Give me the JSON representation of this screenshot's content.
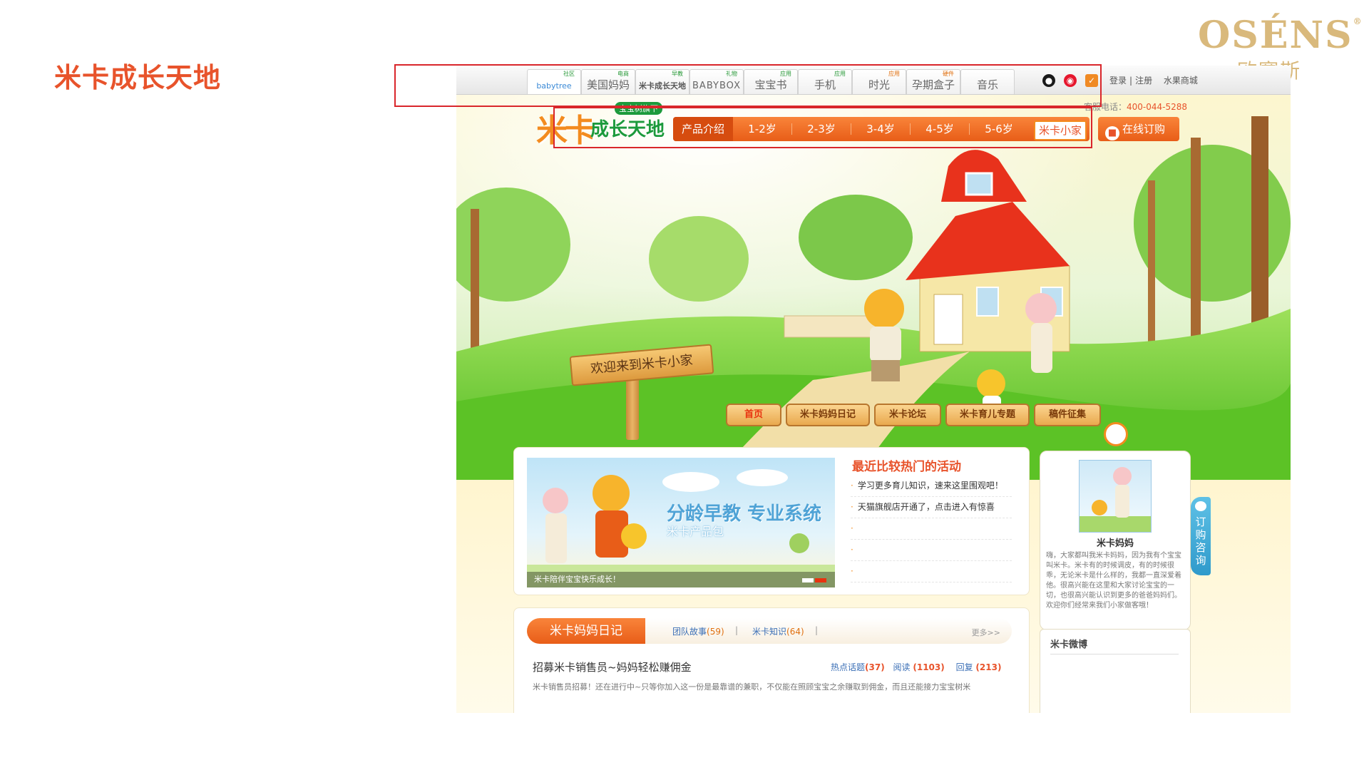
{
  "slide": {
    "title": "米卡成长天地",
    "brand_en": "OSÉNS",
    "brand_reg": "®",
    "brand_cn": "欧赛斯"
  },
  "topnav": {
    "tabs": [
      {
        "tag": "社区",
        "label": "babytree",
        "active": true
      },
      {
        "tag": "电商",
        "label": "美国妈妈"
      },
      {
        "tag": "早教",
        "label": "米卡成长天地"
      },
      {
        "tag": "礼物",
        "label": "BABYBOX"
      },
      {
        "tag": "应用",
        "label": "宝宝书"
      },
      {
        "tag": "应用",
        "label": "手机"
      },
      {
        "tag": "应用",
        "label": "时光",
        "hot": true
      },
      {
        "tag": "硬件",
        "label": "孕期盒子",
        "hot": true
      },
      {
        "tag": "",
        "label": "音乐"
      }
    ],
    "icons": [
      "qq-icon",
      "weibo-icon",
      "shield-icon"
    ],
    "login": "登录",
    "sep": "|",
    "register": "注册",
    "mall": "水果商城"
  },
  "header": {
    "hotline_label": "客服电话：",
    "hotline_number": "400-044-5288",
    "logo_mi": "米卡",
    "logo_text": "成长天地",
    "logo_badge": "宝宝树旗下",
    "nav": [
      "产品介绍",
      "1-2岁",
      "2-3岁",
      "3-4岁",
      "4-5岁",
      "5-6岁",
      "米卡小家"
    ],
    "order_label": "在线订购"
  },
  "scene": {
    "sign_text": "欢迎来到米卡小家",
    "subnav": [
      "首页",
      "米卡妈妈日记",
      "米卡论坛",
      "米卡育儿专题",
      "稿件征集"
    ]
  },
  "slider": {
    "banner_title": "分龄早教 专业系统",
    "banner_sub": "米卡产品包",
    "caption": "米卡陪伴宝宝快乐成长！",
    "dot_colors": [
      "#ffffff",
      "#e8320f"
    ]
  },
  "hot": {
    "title": "最近比较热门的活动",
    "items": [
      "学习更多育儿知识，速来这里围观吧！",
      "天猫旗舰店开通了，点击进入有惊喜",
      "",
      "",
      ""
    ]
  },
  "diary": {
    "tab": "米卡妈妈日记",
    "link1_label": "团队故事",
    "link1_count": "(59)",
    "link2_label": "米卡知识",
    "link2_count": "(64)",
    "sep": "|",
    "more": "更多>>",
    "post_title": "招募米卡销售员~妈妈轻松赚佣金",
    "meta_hot": "热点话题",
    "meta_hot_count": "(37)",
    "meta_read": "阅读",
    "meta_read_count": "(1103)",
    "meta_reply": "回复",
    "meta_reply_count": "(213)",
    "post_excerpt": "米卡销售员招募！还在进行中~只等你加入这一份是最靠谱的兼职，不仅能在照顾宝宝之余赚取到佣金，而且还能接力宝宝树米"
  },
  "mama": {
    "name": "米卡妈妈",
    "desc": "嗨，大家都叫我米卡妈妈，因为我有个宝宝叫米卡。米卡有的时候调皮，有的时候很乖，无论米卡是什么样的，我都一直深爱着他。很高兴能在这里和大家讨论宝宝的一切，也很高兴能认识到更多的爸爸妈妈们。欢迎你们经常来我们小家做客哦！"
  },
  "weibo": {
    "title": "米卡微博"
  },
  "consult": {
    "label": "订购咨询"
  },
  "colors": {
    "accent": "#e8532b",
    "green": "#1c9a3c",
    "orange": "#f38b1f",
    "highlight": "#d9262b"
  }
}
